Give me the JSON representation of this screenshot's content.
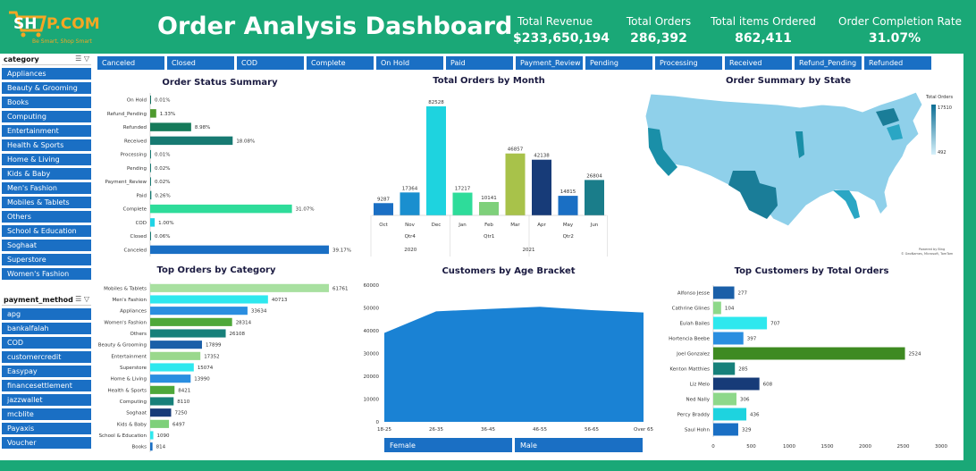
{
  "header": {
    "logo_text": "SHOP.COM",
    "logo_tagline": "Be Smart, Shop Smart",
    "title": "Order Analysis Dashboard",
    "kpis": [
      {
        "label": "Total Revenue",
        "value": "$233,650,194"
      },
      {
        "label": "Total Orders",
        "value": "286,392"
      },
      {
        "label": "Total items Ordered",
        "value": "862,411"
      },
      {
        "label": "Order Completion Rate",
        "value": "31.07%"
      }
    ]
  },
  "slicers": {
    "category": {
      "title": "category",
      "items": [
        "Appliances",
        "Beauty & Grooming",
        "Books",
        "Computing",
        "Entertainment",
        "Health & Sports",
        "Home & Living",
        "Kids & Baby",
        "Men's Fashion",
        "Mobiles & Tablets",
        "Others",
        "School & Education",
        "Soghaat",
        "Superstore",
        "Women's Fashion"
      ]
    },
    "payment_method": {
      "title": "payment_method",
      "items": [
        "apg",
        "bankalfalah",
        "COD",
        "customercredit",
        "Easypay",
        "financesettlement",
        "jazzwallet",
        "mcblite",
        "Payaxis",
        "Voucher"
      ]
    },
    "status": [
      "Canceled",
      "Closed",
      "COD",
      "Complete",
      "On Hold",
      "Paid",
      "Payment_Review",
      "Pending",
      "Processing",
      "Received",
      "Refund_Pending",
      "Refunded"
    ]
  },
  "panels": {
    "status": "Order Status Summary",
    "month": "Total Orders by Month",
    "state": "Order Summary by State",
    "category": "Top Orders by Category",
    "age": "Customers by Age Bracket",
    "customers": "Top Customers by Total Orders"
  },
  "map": {
    "legend_title": "Total Orders",
    "max": "17510",
    "min": "492",
    "credit1": "Powered by Bing",
    "credit2": "© GeoNames, Microsoft, TomTom"
  },
  "gender": [
    "Female",
    "Male"
  ],
  "colors": {
    "header": "#1aa877",
    "slicer": "#1a6fc4"
  },
  "chart_data": [
    {
      "id": "status",
      "type": "bar",
      "orientation": "horizontal",
      "title": "Order Status Summary",
      "categories": [
        "On Hold",
        "Refund_Pending",
        "Refunded",
        "Received",
        "Processing",
        "Pending",
        "Payment_Review",
        "Paid",
        "Complete",
        "COD",
        "Closed",
        "Canceled"
      ],
      "values": [
        0.01,
        1.33,
        8.98,
        18.08,
        0.01,
        0.02,
        0.02,
        0.26,
        31.07,
        1.0,
        0.06,
        39.17
      ],
      "labels": [
        "0.01%",
        "1.33%",
        "8.98%",
        "18.08%",
        "0.01%",
        "0.02%",
        "0.02%",
        "0.26%",
        "31.07%",
        "1.00%",
        "0.06%",
        "39.17%"
      ],
      "colors": [
        "#0e6e5e",
        "#4e9a2e",
        "#157a5a",
        "#177a72",
        "#177a72",
        "#177a72",
        "#177a72",
        "#177a72",
        "#2edc9a",
        "#1fd4e6",
        "#177a72",
        "#1a6fc4"
      ]
    },
    {
      "id": "month",
      "type": "bar",
      "title": "Total Orders by Month",
      "categories": [
        "Oct",
        "Nov",
        "Dec",
        "Jan",
        "Feb",
        "Mar",
        "Apr",
        "May",
        "Jun"
      ],
      "values": [
        9287,
        17364,
        82528,
        17217,
        10141,
        46857,
        42138,
        14815,
        26804
      ],
      "colors": [
        "#1a6fc4",
        "#1a8fcf",
        "#1ed3df",
        "#2edc9a",
        "#7ed07a",
        "#a8c24a",
        "#173b78",
        "#1a6fc4",
        "#1a7d8a"
      ],
      "quarters": [
        "Qtr4",
        "Qtr1",
        "Qtr2"
      ],
      "years": [
        "2020",
        "2021"
      ]
    },
    {
      "id": "category",
      "type": "bar",
      "orientation": "horizontal",
      "title": "Top Orders by Category",
      "categories": [
        "Mobiles & Tablets",
        "Men's Fashion",
        "Appliances",
        "Women's Fashion",
        "Others",
        "Beauty & Grooming",
        "Entertainment",
        "Superstore",
        "Home & Living",
        "Health & Sports",
        "Computing",
        "Soghaat",
        "Kids & Baby",
        "School & Education",
        "Books"
      ],
      "values": [
        61761,
        40713,
        33634,
        28314,
        26108,
        17899,
        17352,
        15074,
        13990,
        8421,
        8110,
        7250,
        6497,
        1090,
        814
      ],
      "colors": [
        "#a8e0a0",
        "#2ee8ee",
        "#2a8ee0",
        "#4ea83a",
        "#17807a",
        "#1a5fa8",
        "#9ad88c",
        "#2ee8ee",
        "#2a8ee0",
        "#4ea83a",
        "#17807a",
        "#173b78",
        "#7ed07a",
        "#2ee8ee",
        "#1a6fc4"
      ]
    },
    {
      "id": "age",
      "type": "area",
      "title": "Customers by Age Bracket",
      "categories": [
        "18-25",
        "26-35",
        "36-45",
        "46-55",
        "56-65",
        "Over 65"
      ],
      "values": [
        39000,
        48500,
        49500,
        50500,
        49000,
        48000
      ],
      "yticks": [
        0,
        10000,
        20000,
        30000,
        40000,
        50000,
        60000
      ],
      "ylim": [
        0,
        60000
      ],
      "color": "#1a82d4"
    },
    {
      "id": "customers",
      "type": "bar",
      "orientation": "horizontal",
      "title": "Top Customers by Total Orders",
      "categories": [
        "Alfonso Jesse",
        "Cathrine Glines",
        "Eulah Bailes",
        "Hortencia Beebe",
        "Joel Gonzalez",
        "Kenton Matthies",
        "Liz Melo",
        "Ned Nally",
        "Percy Braddy",
        "Saul Hohn"
      ],
      "values": [
        277,
        104,
        707,
        397,
        2524,
        285,
        608,
        306,
        436,
        329
      ],
      "colors": [
        "#1a5fa8",
        "#8ed88a",
        "#2ee8ee",
        "#2a8ee0",
        "#3e8a22",
        "#17807a",
        "#173b78",
        "#8ed88a",
        "#1ed3df",
        "#1a6fc4"
      ],
      "xticks": [
        0,
        500,
        1000,
        1500,
        2000,
        2500,
        3000
      ],
      "xlim": [
        0,
        3000
      ]
    }
  ]
}
